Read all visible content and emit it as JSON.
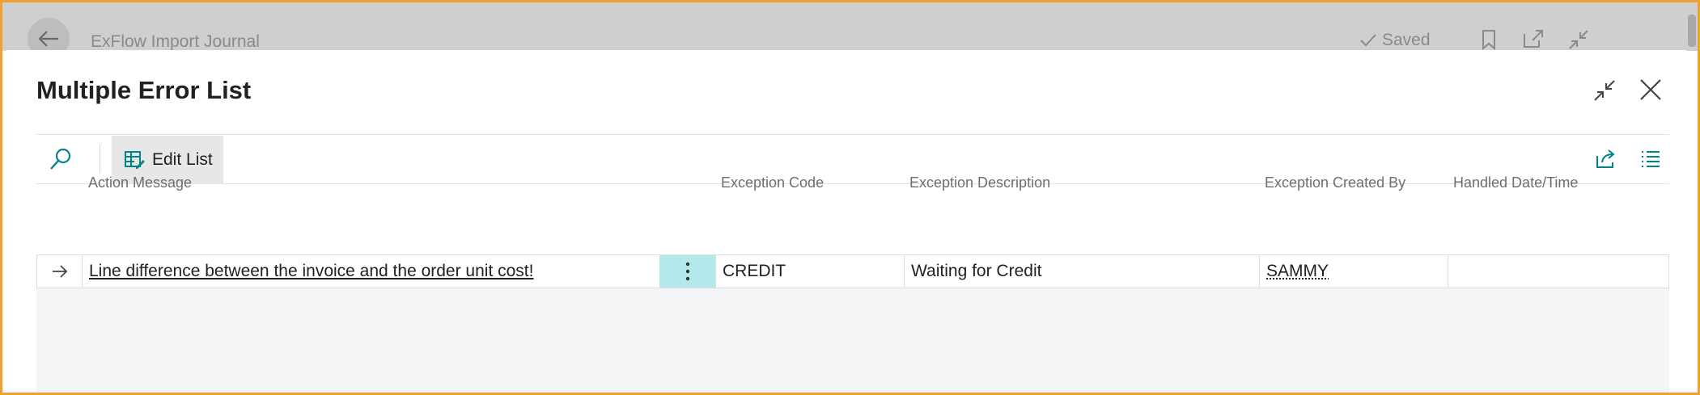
{
  "background_page": {
    "title": "ExFlow Import Journal",
    "saved_label": "Saved"
  },
  "dialog": {
    "title": "Multiple Error List"
  },
  "toolbar": {
    "edit_list_label": "Edit List"
  },
  "table": {
    "columns": [
      "Action Message",
      "Exception Code",
      "Exception Description",
      "Exception Created By",
      "Handled Date/Time"
    ],
    "rows": [
      {
        "action_message": "Line difference between the invoice and the order unit cost!",
        "exception_code": "CREDIT",
        "exception_description": "Waiting for Credit",
        "exception_created_by": "SAMMY",
        "handled_datetime": ""
      }
    ]
  },
  "colors": {
    "accent": "#008489",
    "selected_cell": "#b5e8ec",
    "frame": "#f0a030"
  },
  "icons": [
    "back-arrow-icon",
    "checkmark-icon",
    "bookmark-icon",
    "open-new-window-icon",
    "collapse-icon",
    "close-icon",
    "search-icon",
    "edit-list-icon",
    "share-icon",
    "list-view-icon",
    "row-arrow-icon",
    "more-options-icon"
  ]
}
